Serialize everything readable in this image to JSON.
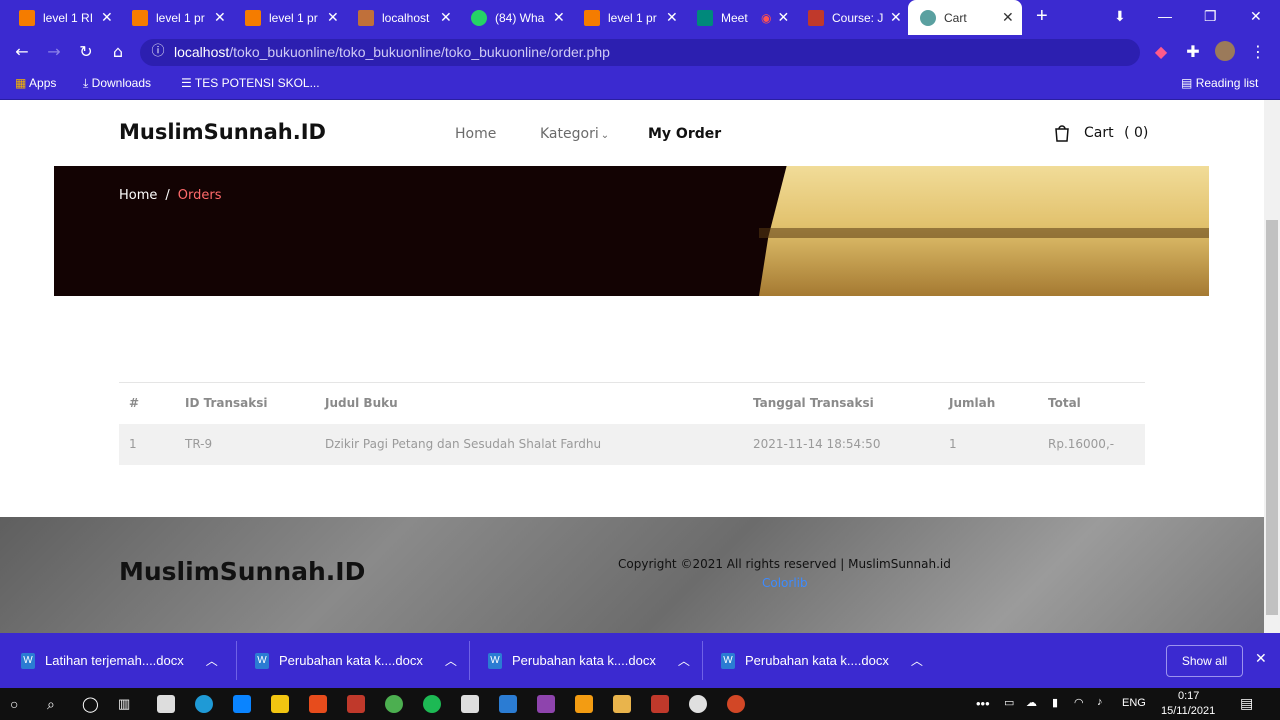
{
  "browser": {
    "tabs": [
      {
        "title": "level 1 RI",
        "color": "#f57c00"
      },
      {
        "title": "level 1 pr",
        "color": "#f57c00"
      },
      {
        "title": "level 1 pr",
        "color": "#f57c00"
      },
      {
        "title": "localhost",
        "color": "#c0703a"
      },
      {
        "title": "(84) Wha",
        "color": "#25d366"
      },
      {
        "title": "level 1 pr",
        "color": "#f57c00"
      },
      {
        "title": "Meet",
        "color": "#00897b"
      },
      {
        "title": "Course: J",
        "color": "#c0392b"
      },
      {
        "title": "Cart",
        "color": "#5aa0a0"
      }
    ],
    "url_host": "localhost",
    "url_path": "/toko_bukuonline/toko_bukuonline/toko_bukuonline/order.php",
    "bookmarks": {
      "apps": "Apps",
      "downloads": "Downloads",
      "tes": "TES POTENSI SKOL...",
      "reading_list": "Reading list"
    }
  },
  "site": {
    "brand": "MuslimSunnah.ID",
    "nav": {
      "home": "Home",
      "kategori": "Kategori",
      "my_order": "My Order"
    },
    "cart_label": "Cart",
    "cart_count": "( 0)",
    "breadcrumb": {
      "home": "Home",
      "sep": "/",
      "current": "Orders"
    }
  },
  "orders": {
    "headers": [
      "#",
      "ID Transaksi",
      "Judul Buku",
      "Tanggal Transaksi",
      "Jumlah",
      "Total"
    ],
    "rows": [
      [
        "1",
        "TR-9",
        "Dzikir Pagi Petang dan Sesudah Shalat Fardhu",
        "2021-11-14 18:54:50",
        "1",
        "Rp.16000,-"
      ]
    ]
  },
  "footer": {
    "brand": "MuslimSunnah.ID",
    "copyright": "Copyright ©2021 All rights reserved | MuslimSunnah.id",
    "credit": "Colorlib"
  },
  "downloads": {
    "items": [
      "Latihan terjemah....docx",
      "Perubahan kata k....docx",
      "Perubahan kata k....docx",
      "Perubahan kata k....docx"
    ],
    "show_all": "Show all"
  },
  "taskbar": {
    "lang": "ENG",
    "time": "0:17",
    "date": "15/11/2021"
  },
  "colors": {
    "chrome_accent": "#3b2ad0",
    "breadcrumb_current": "#ff6b6b",
    "link_blue": "#3d8bff"
  }
}
